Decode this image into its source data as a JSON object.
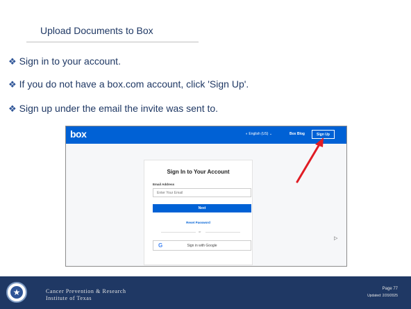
{
  "slide": {
    "title": "Upload Documents to Box",
    "bullets": [
      "Sign in to your account.",
      "If you do not have a box.com account, click 'Sign Up'.",
      "Sign up under the email the invite was sent to."
    ],
    "bullet_glyph": "❖"
  },
  "box": {
    "logo": "box",
    "language": "◐ English (US) ⌄",
    "blog": "Box Blog",
    "signup": "Sign Up",
    "card_title": "Sign In to Your Account",
    "email_label": "Email Address",
    "email_placeholder": "Enter Your Email",
    "next": "Next",
    "reset": "Reset Password",
    "or": "or",
    "google": "Sign in with Google",
    "google_glyph": "G",
    "brand_color": "#0061d5"
  },
  "annotation": {
    "arrow_color": "#e01c24"
  },
  "footer": {
    "org_line1": "Cancer Prevention & Research",
    "org_line2": "Institute of Texas",
    "page": "Page 77",
    "updated": "Updated: 2/20/2025",
    "bg_color": "#1f3864"
  }
}
